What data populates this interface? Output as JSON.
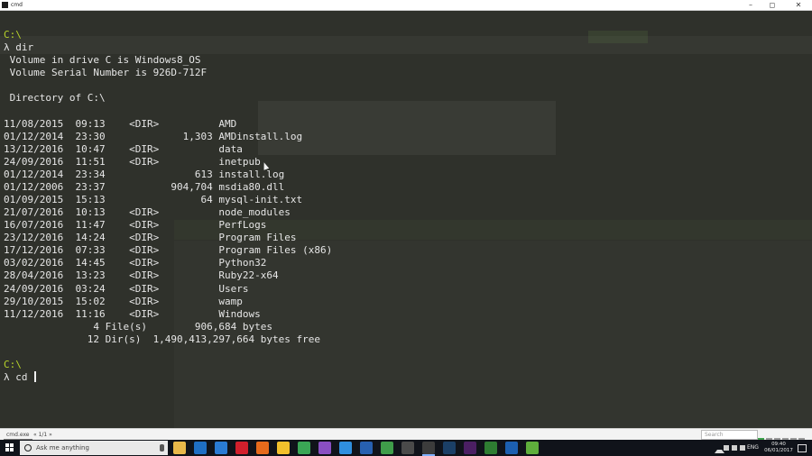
{
  "window": {
    "title": "cmd",
    "minimize": "–",
    "maximize": "◻",
    "close": "✕"
  },
  "console": {
    "lines": [
      {
        "segments": [
          {
            "text": "C:\\",
            "style": "path"
          }
        ]
      },
      {
        "segments": [
          {
            "text": "λ dir",
            "style": "normal"
          }
        ]
      },
      {
        "segments": [
          {
            "text": " Volume in drive C is Windows8_OS",
            "style": "normal"
          }
        ]
      },
      {
        "segments": [
          {
            "text": " Volume Serial Number is 926D-712F",
            "style": "normal"
          }
        ]
      },
      {
        "segments": [
          {
            "text": "",
            "style": "normal"
          }
        ]
      },
      {
        "segments": [
          {
            "text": " Directory of C:\\",
            "style": "normal"
          }
        ]
      },
      {
        "segments": [
          {
            "text": "",
            "style": "normal"
          }
        ]
      },
      {
        "segments": [
          {
            "text": "11/08/2015  09:13    <DIR>          AMD",
            "style": "normal"
          }
        ]
      },
      {
        "segments": [
          {
            "text": "01/12/2014  23:30             1,303 AMDinstall.log",
            "style": "normal"
          }
        ]
      },
      {
        "segments": [
          {
            "text": "13/12/2016  10:47    <DIR>          data",
            "style": "normal"
          }
        ]
      },
      {
        "segments": [
          {
            "text": "24/09/2016  11:51    <DIR>          inetpub",
            "style": "normal"
          }
        ]
      },
      {
        "segments": [
          {
            "text": "01/12/2014  23:34               613 install.log",
            "style": "normal"
          }
        ]
      },
      {
        "segments": [
          {
            "text": "01/12/2006  23:37           904,704 msdia80.dll",
            "style": "normal"
          }
        ]
      },
      {
        "segments": [
          {
            "text": "01/09/2015  15:13                64 mysql-init.txt",
            "style": "normal"
          }
        ]
      },
      {
        "segments": [
          {
            "text": "21/07/2016  10:13    <DIR>          node_modules",
            "style": "normal"
          }
        ]
      },
      {
        "segments": [
          {
            "text": "16/07/2016  11:47    <DIR>          PerfLogs",
            "style": "normal"
          }
        ]
      },
      {
        "segments": [
          {
            "text": "23/12/2016  14:24    <DIR>          Program Files",
            "style": "normal"
          }
        ]
      },
      {
        "segments": [
          {
            "text": "17/12/2016  07:33    <DIR>          Program Files (x86)",
            "style": "normal"
          }
        ]
      },
      {
        "segments": [
          {
            "text": "03/02/2016  14:45    <DIR>          Python32",
            "style": "normal"
          }
        ]
      },
      {
        "segments": [
          {
            "text": "28/04/2016  13:23    <DIR>          Ruby22-x64",
            "style": "normal"
          }
        ]
      },
      {
        "segments": [
          {
            "text": "24/09/2016  03:24    <DIR>          Users",
            "style": "normal"
          }
        ]
      },
      {
        "segments": [
          {
            "text": "29/10/2015  15:02    <DIR>          wamp",
            "style": "normal"
          }
        ]
      },
      {
        "segments": [
          {
            "text": "11/12/2016  11:16    <DIR>          Windows",
            "style": "normal"
          }
        ]
      },
      {
        "segments": [
          {
            "text": "               4 File(s)        906,684 bytes",
            "style": "normal"
          }
        ]
      },
      {
        "segments": [
          {
            "text": "              12 Dir(s)  1,490,413,297,664 bytes free",
            "style": "normal"
          }
        ]
      },
      {
        "segments": [
          {
            "text": "",
            "style": "normal"
          }
        ]
      },
      {
        "segments": [
          {
            "text": "C:\\",
            "style": "path"
          }
        ]
      },
      {
        "segments": [
          {
            "text": "λ cd ",
            "style": "normal"
          }
        ]
      }
    ],
    "cursor_line": 27,
    "colors": {
      "background": "#2f312b",
      "text": "#e6e6e6",
      "path": "#b7d32a"
    }
  },
  "tabs": {
    "items": [
      {
        "label": "cmd.exe",
        "active": true
      },
      {
        "label": "« 1/1 »",
        "active": false
      }
    ],
    "search_placeholder": "Search"
  },
  "taskbar": {
    "search_text": "Ask me anything",
    "apps": [
      {
        "name": "file-explorer-icon",
        "color": "#e8b84a"
      },
      {
        "name": "outlook-icon",
        "color": "#1f6fc4"
      },
      {
        "name": "edge-icon",
        "color": "#2a7bd4"
      },
      {
        "name": "opera-icon",
        "color": "#d21f2c"
      },
      {
        "name": "firefox-icon",
        "color": "#e66a1c"
      },
      {
        "name": "chrome-canary-icon",
        "color": "#f2c02c"
      },
      {
        "name": "chrome-icon",
        "color": "#3aa655"
      },
      {
        "name": "visual-studio-icon",
        "color": "#8a4fc2"
      },
      {
        "name": "safari-icon",
        "color": "#2f8fe0"
      },
      {
        "name": "source-tree-icon",
        "color": "#2760b0"
      },
      {
        "name": "green-app-icon",
        "color": "#3f9d4a"
      },
      {
        "name": "obs-icon",
        "color": "#4a4a4a"
      },
      {
        "name": "conemu-icon",
        "color": "#3c3c3c"
      },
      {
        "name": "photoshop-icon",
        "color": "#1b3f66"
      },
      {
        "name": "premiere-icon",
        "color": "#4b1f63"
      },
      {
        "name": "terminal-icon",
        "color": "#2e7d32"
      },
      {
        "name": "media-player-icon",
        "color": "#1c5fb0"
      },
      {
        "name": "android-icon",
        "color": "#5fae3c"
      }
    ],
    "active_app_index": 12,
    "tray": {
      "language": "ENG",
      "time": "09:40",
      "date": "06/01/2017"
    }
  }
}
